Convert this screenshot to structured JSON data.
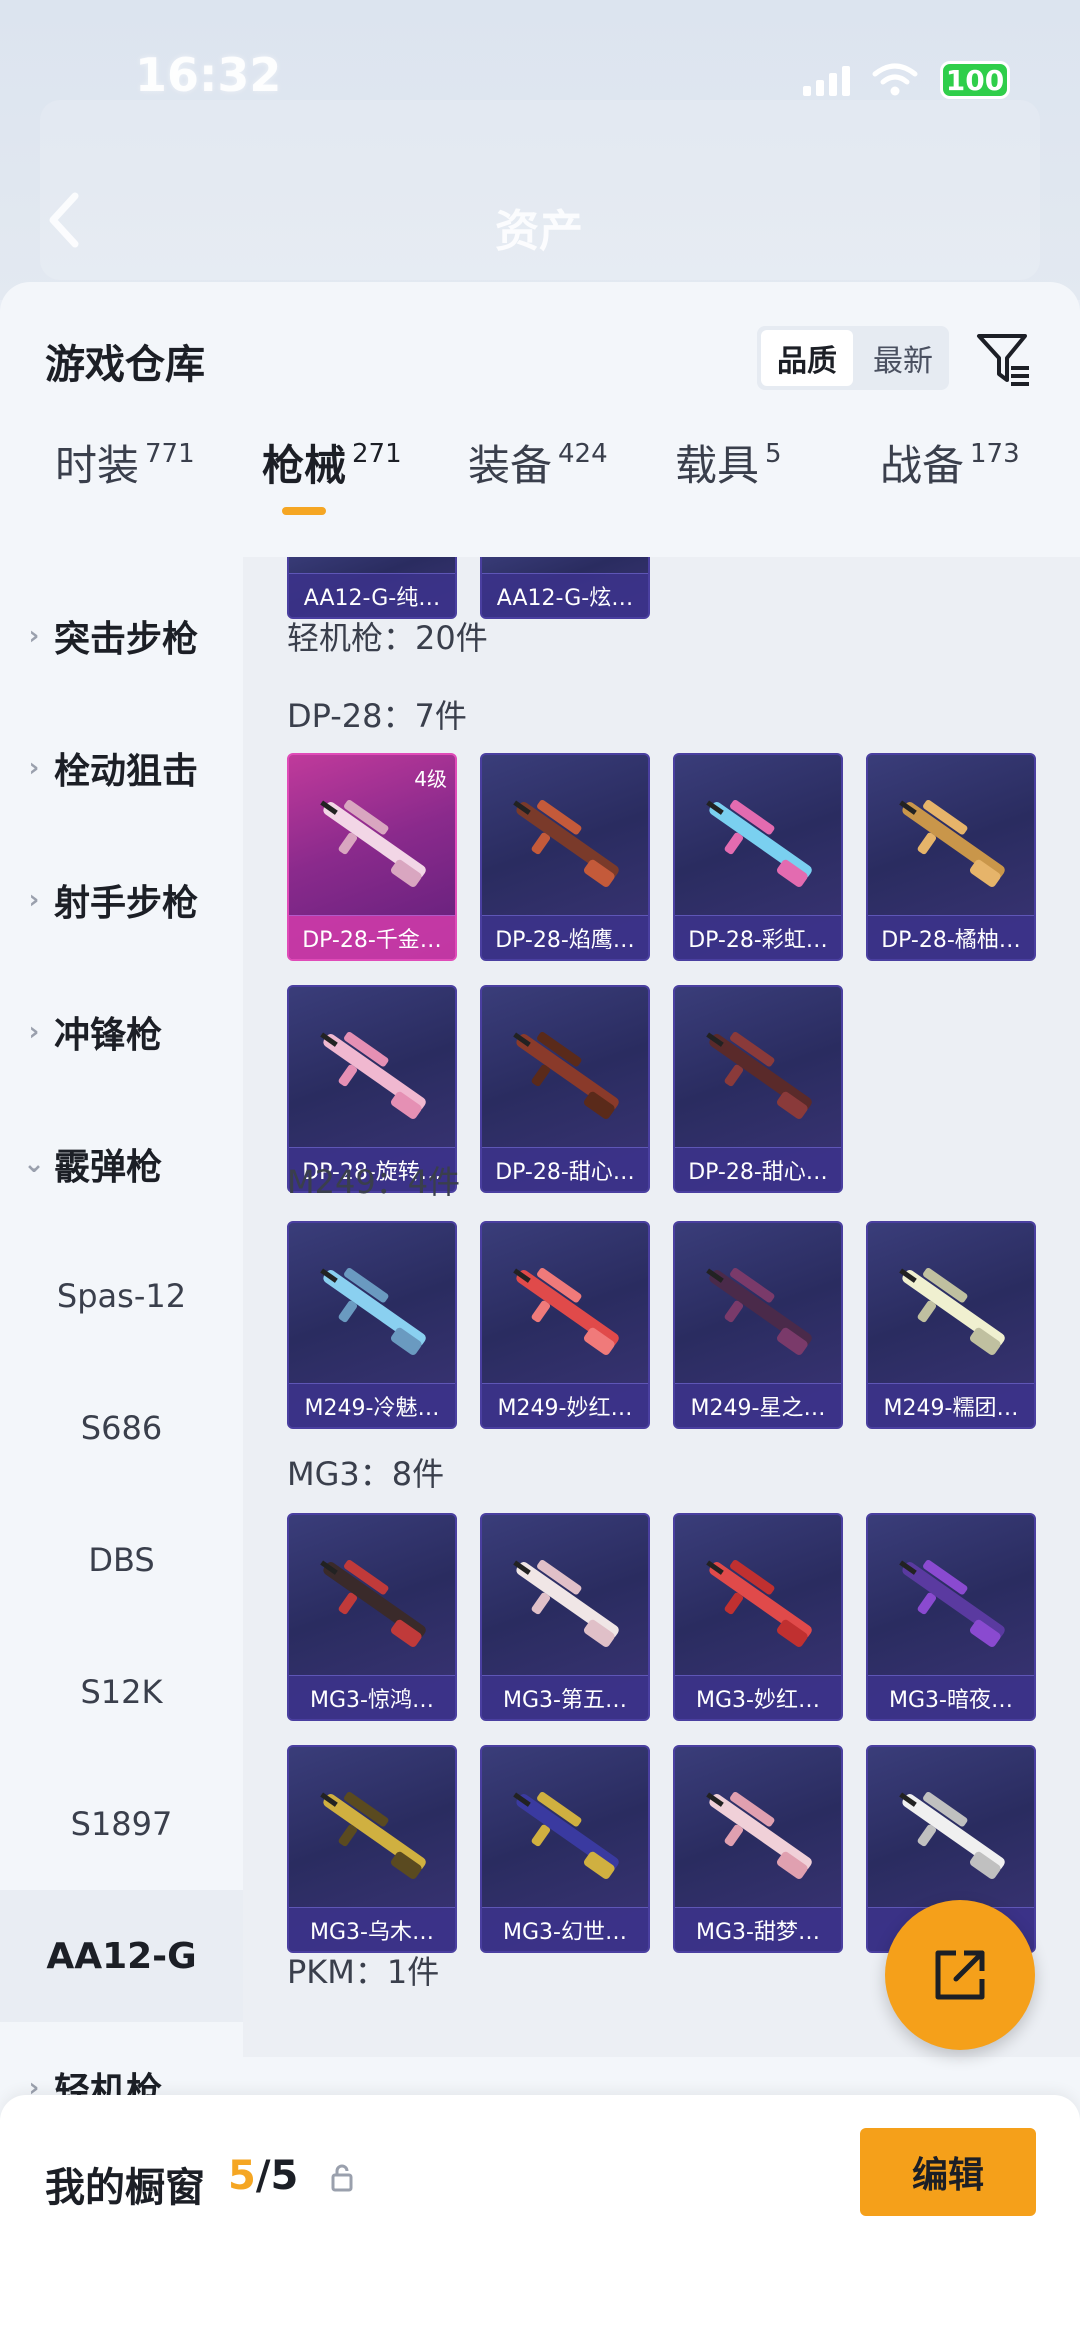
{
  "status": {
    "time": "16:32",
    "battery": "100"
  },
  "header": {
    "title": "资产"
  },
  "sheet": {
    "title": "游戏仓库",
    "sort_options": [
      "品质",
      "最新"
    ],
    "tabs": [
      {
        "label": "时装",
        "count": "771"
      },
      {
        "label": "枪械",
        "count": "271"
      },
      {
        "label": "装备",
        "count": "424"
      },
      {
        "label": "载具",
        "count": "5"
      },
      {
        "label": "战备",
        "count": "173"
      }
    ]
  },
  "sidebar": {
    "groups": [
      "突击步枪",
      "栓动狙击",
      "射手步枪",
      "冲锋枪",
      "霰弹枪"
    ],
    "sub_items": [
      "Spas-12",
      "S686",
      "DBS",
      "S12K",
      "S1897",
      "AA12-G"
    ],
    "after": "轻机枪"
  },
  "content": {
    "top_cards": [
      "AA12-G-纯…",
      "AA12-G-炫…"
    ],
    "lmg_header": "轻机枪：20件",
    "sections": [
      {
        "title": "DP-28：7件",
        "items": [
          "DP-28-千金…",
          "DP-28-焰鹰…",
          "DP-28-彩虹…",
          "DP-28-橘柚…",
          "DP-28-旋转…",
          "DP-28-甜心…",
          "DP-28-甜心…"
        ]
      },
      {
        "title": "M249：4件",
        "items": [
          "M249-冷魅…",
          "M249-妙红…",
          "M249-星之…",
          "M249-糯团…"
        ]
      },
      {
        "title": "MG3：8件",
        "items": [
          "MG3-惊鸿…",
          "MG3-第五…",
          "MG3-妙红…",
          "MG3-暗夜…",
          "MG3-乌木…",
          "MG3-幻世…",
          "MG3-甜梦…",
          "MG3-…"
        ]
      }
    ],
    "first_badge": "4级",
    "next_section": "PKM：1件"
  },
  "bottom": {
    "label": "我的橱窗",
    "current": "5",
    "total": "/5",
    "edit": "编辑"
  },
  "colors": {
    "accent": "#f5a623",
    "card_bg": "#2a2c60",
    "card_highlight": "#c03a9b"
  }
}
